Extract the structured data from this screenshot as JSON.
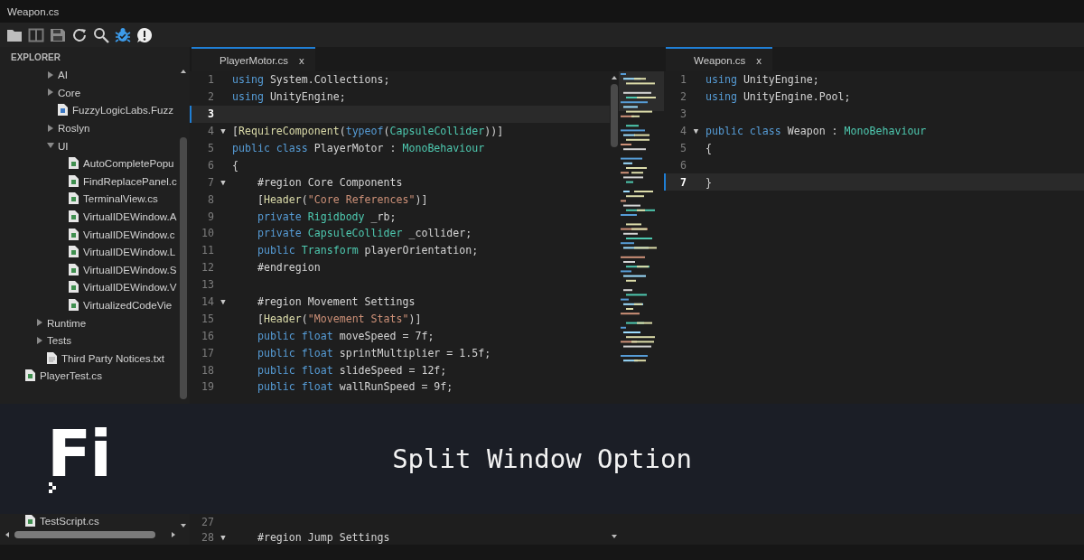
{
  "window": {
    "title": "Weapon.cs"
  },
  "explorer": {
    "title": "EXPLORER",
    "items": [
      {
        "children": [
          {
            "children": [
              {
                "children": [
                  {
                    "label": "AI",
                    "kind": "folder",
                    "expanded": false
                  },
                  {
                    "label": "Core",
                    "kind": "folder",
                    "expanded": false
                  },
                  {
                    "label": "FuzzyLogicLabs.Fuzz",
                    "kind": "asset"
                  },
                  {
                    "label": "Roslyn",
                    "kind": "folder",
                    "expanded": false
                  },
                  {
                    "label": "UI",
                    "kind": "folder",
                    "expanded": true,
                    "children": [
                      {
                        "label": "AutoCompletePopu",
                        "kind": "cs"
                      },
                      {
                        "label": "FindReplacePanel.c",
                        "kind": "cs"
                      },
                      {
                        "label": "TerminalView.cs",
                        "kind": "cs"
                      },
                      {
                        "label": "VirtualIDEWindow.A",
                        "kind": "cs"
                      },
                      {
                        "label": "VirtualIDEWindow.c",
                        "kind": "cs"
                      },
                      {
                        "label": "VirtualIDEWindow.L",
                        "kind": "cs"
                      },
                      {
                        "label": "VirtualIDEWindow.S",
                        "kind": "cs"
                      },
                      {
                        "label": "VirtualIDEWindow.V",
                        "kind": "cs"
                      },
                      {
                        "label": "VirtualizedCodeVie",
                        "kind": "cs"
                      }
                    ]
                  }
                ]
              },
              {
                "label": "Runtime",
                "kind": "folder",
                "expanded": false
              },
              {
                "label": "Tests",
                "kind": "folder",
                "expanded": false
              },
              {
                "label": "Third Party Notices.txt",
                "kind": "txt"
              }
            ]
          }
        ]
      },
      {
        "label": "PlayerTest.cs",
        "kind": "cs"
      }
    ],
    "items_after_overlay": [
      {
        "label": "TestScript.cs",
        "kind": "cs"
      }
    ]
  },
  "editors": [
    {
      "tab": {
        "label": "PlayerMotor.cs",
        "close": "x",
        "selected": true
      },
      "minimap": true,
      "lines": [
        {
          "n": "1",
          "current": false,
          "tokens": [
            {
              "kind": "kw",
              "text": "using"
            },
            {
              "kind": "plain",
              "text": " System.Collections;"
            }
          ]
        },
        {
          "n": "2",
          "current": false,
          "tokens": [
            {
              "kind": "kw",
              "text": "using"
            },
            {
              "kind": "plain",
              "text": " UnityEngine;"
            }
          ]
        },
        {
          "n": "3",
          "current": true
        },
        {
          "n": "4",
          "current": false,
          "fold": "▼",
          "tokens": [
            {
              "kind": "plain",
              "text": "["
            },
            {
              "kind": "attr",
              "text": "RequireComponent"
            },
            {
              "kind": "plain",
              "text": "("
            },
            {
              "kind": "kw",
              "text": "typeof"
            },
            {
              "kind": "plain",
              "text": "("
            },
            {
              "kind": "type",
              "text": "CapsuleCollider"
            },
            {
              "kind": "plain",
              "text": "))]"
            }
          ]
        },
        {
          "n": "5",
          "current": false,
          "tokens": [
            {
              "kind": "kw",
              "text": "public class"
            },
            {
              "kind": "plain",
              "text": " PlayerMotor : "
            },
            {
              "kind": "type",
              "text": "MonoBehaviour"
            }
          ]
        },
        {
          "n": "6",
          "current": false,
          "tokens": [
            {
              "kind": "plain",
              "text": "{"
            }
          ]
        },
        {
          "n": "7",
          "current": false,
          "fold": "▼",
          "tokens": [
            {
              "kind": "plain",
              "text": "    #region Core Components"
            }
          ]
        },
        {
          "n": "8",
          "current": false,
          "tokens": [
            {
              "kind": "plain",
              "text": "    ["
            },
            {
              "kind": "attr",
              "text": "Header"
            },
            {
              "kind": "plain",
              "text": "("
            },
            {
              "kind": "str",
              "text": "\"Core References\""
            },
            {
              "kind": "plain",
              "text": ")]"
            }
          ]
        },
        {
          "n": "9",
          "current": false,
          "tokens": [
            {
              "kind": "kw",
              "text": "    private"
            },
            {
              "kind": "type",
              "text": " Rigidbody"
            },
            {
              "kind": "plain",
              "text": " _rb;"
            }
          ]
        },
        {
          "n": "10",
          "current": false,
          "tokens": [
            {
              "kind": "kw",
              "text": "    private"
            },
            {
              "kind": "type",
              "text": " CapsuleCollider"
            },
            {
              "kind": "plain",
              "text": " _collider;"
            }
          ]
        },
        {
          "n": "11",
          "current": false,
          "tokens": [
            {
              "kind": "kw",
              "text": "    public"
            },
            {
              "kind": "type",
              "text": " Transform"
            },
            {
              "kind": "plain",
              "text": " playerOrientation;"
            }
          ]
        },
        {
          "n": "12",
          "current": false,
          "tokens": [
            {
              "kind": "plain",
              "text": "    #endregion"
            }
          ]
        },
        {
          "n": "13",
          "current": false
        },
        {
          "n": "14",
          "current": false,
          "fold": "▼",
          "tokens": [
            {
              "kind": "plain",
              "text": "    #region Movement Settings"
            }
          ]
        },
        {
          "n": "15",
          "current": false,
          "tokens": [
            {
              "kind": "plain",
              "text": "    ["
            },
            {
              "kind": "attr",
              "text": "Header"
            },
            {
              "kind": "plain",
              "text": "("
            },
            {
              "kind": "str",
              "text": "\"Movement Stats\""
            },
            {
              "kind": "plain",
              "text": ")]"
            }
          ]
        },
        {
          "n": "16",
          "current": false,
          "tokens": [
            {
              "kind": "kw",
              "text": "    public float"
            },
            {
              "kind": "plain",
              "text": " moveSpeed = 7f;"
            }
          ]
        },
        {
          "n": "17",
          "current": false,
          "tokens": [
            {
              "kind": "kw",
              "text": "    public float"
            },
            {
              "kind": "plain",
              "text": " sprintMultiplier = 1.5f;"
            }
          ]
        },
        {
          "n": "18",
          "current": false,
          "tokens": [
            {
              "kind": "kw",
              "text": "    public float"
            },
            {
              "kind": "plain",
              "text": " slideSpeed = 12f;"
            }
          ]
        },
        {
          "n": "19",
          "current": false,
          "tokens": [
            {
              "kind": "kw",
              "text": "    public float"
            },
            {
              "kind": "plain",
              "text": " wallRunSpeed = 9f;"
            }
          ]
        }
      ],
      "lines_after_overlay": [
        {
          "n": "27",
          "current": false
        },
        {
          "n": "28",
          "current": false,
          "fold": "▼",
          "tokens": [
            {
              "kind": "plain",
              "text": "    #region Jump Settings"
            }
          ]
        }
      ]
    },
    {
      "tab": {
        "label": "Weapon.cs",
        "close": "x",
        "selected": true
      },
      "minimap": false,
      "lines": [
        {
          "n": "1",
          "current": false,
          "tokens": [
            {
              "kind": "kw",
              "text": "using"
            },
            {
              "kind": "plain",
              "text": " UnityEngine;"
            }
          ]
        },
        {
          "n": "2",
          "current": false,
          "tokens": [
            {
              "kind": "kw",
              "text": "using"
            },
            {
              "kind": "plain",
              "text": " UnityEngine.Pool;"
            }
          ]
        },
        {
          "n": "3",
          "current": false
        },
        {
          "n": "4",
          "current": false,
          "fold": "▼",
          "tokens": [
            {
              "kind": "kw",
              "text": "public class"
            },
            {
              "kind": "plain",
              "text": " Weapon : "
            },
            {
              "kind": "type",
              "text": "MonoBehaviour"
            }
          ]
        },
        {
          "n": "5",
          "current": false,
          "tokens": [
            {
              "kind": "plain",
              "text": "{"
            }
          ]
        },
        {
          "n": "6",
          "current": false
        },
        {
          "n": "7",
          "current": true,
          "tokens": [
            {
              "kind": "plain",
              "text": "}"
            }
          ]
        }
      ]
    }
  ],
  "banner": {
    "logo": "Fi",
    "title": "Split Window Option"
  }
}
